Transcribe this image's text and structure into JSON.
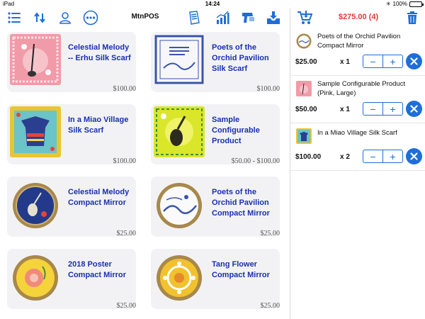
{
  "status_bar": {
    "carrier": "iPad",
    "time": "14:24",
    "battery": "100%",
    "battery_level": 1.0
  },
  "header": {
    "title": "MtnPOS",
    "icons": [
      "menu-icon",
      "sync-icon",
      "user-icon",
      "more-icon",
      "report-icon",
      "chart-icon",
      "scanner-icon",
      "inbox-icon"
    ]
  },
  "products": [
    {
      "name": "Celestial Melody -- Erhu Silk Scarf",
      "price": "$100.00",
      "thumb": "pink-erhu-scarf"
    },
    {
      "name": "Poets of the Orchid Pavilion Silk Scarf",
      "price": "$100.00",
      "thumb": "blue-white-scarf"
    },
    {
      "name": "In a Miao Village Silk Scarf",
      "price": "$100.00",
      "thumb": "miao-scarf"
    },
    {
      "name": "Sample Configurable Product",
      "price": "$50.00 - $100.00",
      "thumb": "yellow-pipa-scarf"
    },
    {
      "name": "Celestial Melody Compact Mirror",
      "price": "$25.00",
      "thumb": "blue-mirror"
    },
    {
      "name": "Poets of the Orchid Pavilion Compact Mirror",
      "price": "$25.00",
      "thumb": "blue-white-mirror"
    },
    {
      "name": "2018 Poster Compact Mirror",
      "price": "$25.00",
      "thumb": "yellow-flower-mirror"
    },
    {
      "name": "Tang Flower Compact Mirror",
      "price": "$25.00",
      "thumb": "tang-flower-mirror"
    }
  ],
  "cart": {
    "total": "$275.00 (4)",
    "icons": [
      "cart-icon",
      "trash-icon"
    ],
    "items": [
      {
        "name": "Poets of the Orchid Pavilion Compact Mirror",
        "price": "$25.00",
        "qty": "x 1"
      },
      {
        "name": "Sample Configurable Product (Pink, Large)",
        "price": "$50.00",
        "qty": "x 1"
      },
      {
        "name": "In a Miao Village Silk Scarf",
        "price": "$100.00",
        "qty": "x 2"
      }
    ],
    "stepper": {
      "minus": "−",
      "plus": "+"
    }
  },
  "colors": {
    "accent": "#1e6ed8",
    "product_name": "#1a2fb0",
    "total": "#e53935"
  }
}
